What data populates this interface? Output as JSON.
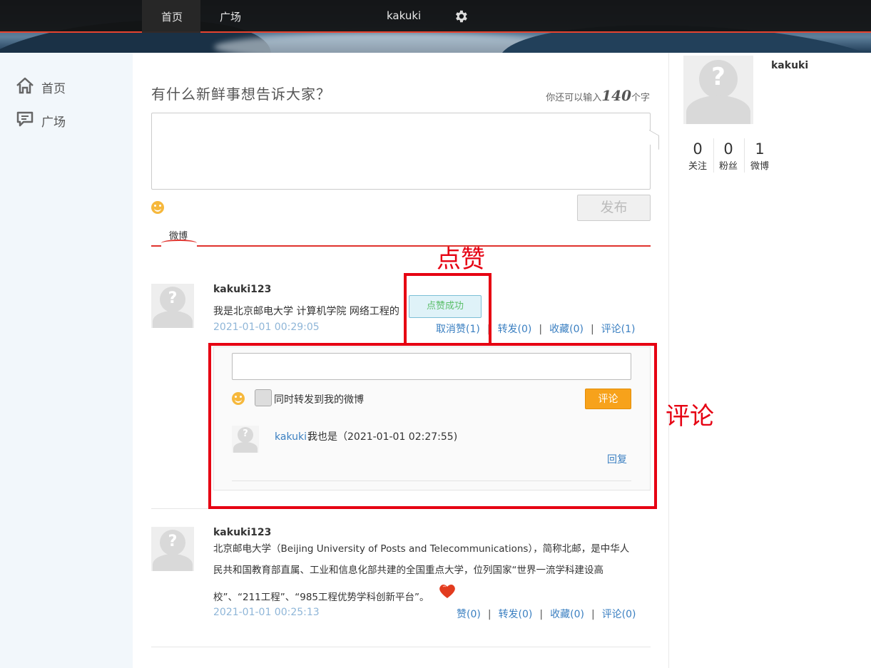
{
  "navbar": {
    "home": "首页",
    "square": "广场",
    "username": "kakuki",
    "settings_icon": "gear-icon"
  },
  "sidebar": {
    "items": [
      {
        "label": "首页",
        "icon": "home-icon"
      },
      {
        "label": "广场",
        "icon": "chat-icon"
      }
    ]
  },
  "composer": {
    "title": "有什么新鲜事想告诉大家？",
    "remaining_prefix": "你还可以输入",
    "remaining_count": "140",
    "remaining_suffix": "个字",
    "publish": "发布"
  },
  "feed_tab": "微博",
  "posts": [
    {
      "user": "kakuki123",
      "text": "我是北京邮电大学 计算机学院 网络工程的",
      "time": "2021-01-01 00:29:05",
      "like": "取消赞(1)",
      "repost": "转发(0)",
      "favorite": "收藏(0)",
      "comment": "评论(1)"
    },
    {
      "user": "kakuki123",
      "text_lines": [
        "北京邮电大学（Beijing University of Posts and Telecommunications），简称北邮，是中华人",
        "民共和国教育部直属、工业和信息化部共建的全国重点大学，位列国家“世界一流学科建设高",
        "校”、“211工程”、“985工程优势学科创新平台”。"
      ],
      "time": "2021-01-01 00:25:13",
      "like": "赞(0)",
      "repost": "转发(0)",
      "favorite": "收藏(0)",
      "comment": "评论(0)"
    }
  ],
  "separator": "|",
  "toast": "点赞成功",
  "comment_panel": {
    "also_repost": "同时转发到我的微博",
    "submit": "评论",
    "comments": [
      {
        "user": "kakuki",
        "sep": "：",
        "text": "我也是（2021-01-01 02:27:55)",
        "reply": "回复"
      }
    ]
  },
  "profile": {
    "name": "kakuki",
    "stats": [
      {
        "num": "0",
        "label": "关注"
      },
      {
        "num": "0",
        "label": "粉丝"
      },
      {
        "num": "1",
        "label": "微博"
      }
    ]
  },
  "annotations": {
    "like_label": "点赞",
    "comment_label": "评论",
    "color": "#e60012"
  },
  "colors": {
    "accent_red": "#e0332d",
    "link_blue": "#3a7fc1",
    "time_blue": "#8fb6d8",
    "comment_orange": "#f7a21b"
  }
}
